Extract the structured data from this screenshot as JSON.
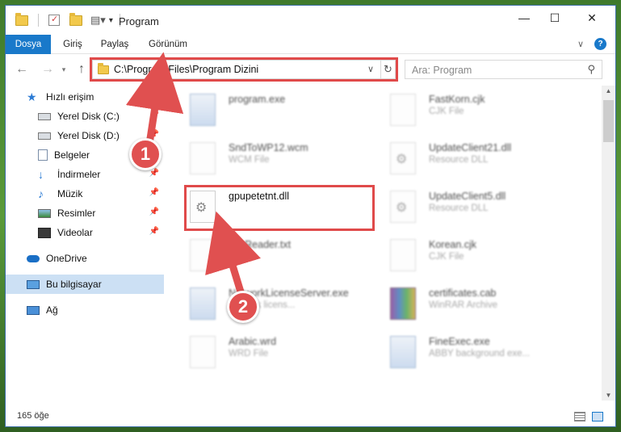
{
  "window": {
    "title": "Program"
  },
  "ribbon": {
    "tabs": [
      "Dosya",
      "Giriş",
      "Paylaş",
      "Görünüm"
    ]
  },
  "address": {
    "path": "C:\\Program Files\\Program Dizini",
    "search_placeholder": "Ara: Program"
  },
  "sidebar": {
    "items": [
      {
        "label": "Hızlı erişim",
        "icon": "star-icon"
      },
      {
        "label": "Yerel Disk (C:)",
        "icon": "drive-icon",
        "pinned": true
      },
      {
        "label": "Yerel Disk (D:)",
        "icon": "drive-icon",
        "pinned": true
      },
      {
        "label": "Belgeler",
        "icon": "documents-icon",
        "pinned": true
      },
      {
        "label": "İndirmeler",
        "icon": "downloads-icon",
        "pinned": true
      },
      {
        "label": "Müzik",
        "icon": "music-icon",
        "pinned": true
      },
      {
        "label": "Resimler",
        "icon": "pictures-icon",
        "pinned": true
      },
      {
        "label": "Videolar",
        "icon": "videos-icon",
        "pinned": true
      },
      {
        "label": "OneDrive",
        "icon": "onedrive-icon"
      },
      {
        "label": "Bu bilgisayar",
        "icon": "computer-icon",
        "selected": true
      },
      {
        "label": "Ağ",
        "icon": "network-icon"
      }
    ]
  },
  "files": [
    {
      "name": "program.exe",
      "type": "",
      "icon": "exe-icon"
    },
    {
      "name": "FastKorn.cjk",
      "type": "CJK File",
      "icon": "file-icon"
    },
    {
      "name": "SndToWP12.wcm",
      "type": "WCM File",
      "icon": "file-icon"
    },
    {
      "name": "UpdateClient21.dll",
      "type": "Resource DLL",
      "icon": "dll-icon"
    },
    {
      "name": "gpupetetnt.dll",
      "type": "",
      "icon": "dll-icon"
    },
    {
      "name": "UpdateClient5.dll",
      "type": "Resource DLL",
      "icon": "dll-icon"
    },
    {
      "name": "fineReader.txt",
      "type": "T File",
      "icon": "file-icon"
    },
    {
      "name": "Korean.cjk",
      "type": "CJK File",
      "icon": "file-icon"
    },
    {
      "name": "NetworkLicenseServer.exe",
      "type": "network licens...",
      "icon": "exe-icon"
    },
    {
      "name": "certificates.cab",
      "type": "WinRAR Archive",
      "icon": "rar-icon"
    },
    {
      "name": "Arabic.wrd",
      "type": "WRD File",
      "icon": "file-icon"
    },
    {
      "name": "FineExec.exe",
      "type": "ABBY background exe...",
      "icon": "exe-icon"
    }
  ],
  "status": {
    "count": "165 öğe"
  },
  "annotations": {
    "step1": "1",
    "step2": "2",
    "color": "#e04a4a"
  }
}
